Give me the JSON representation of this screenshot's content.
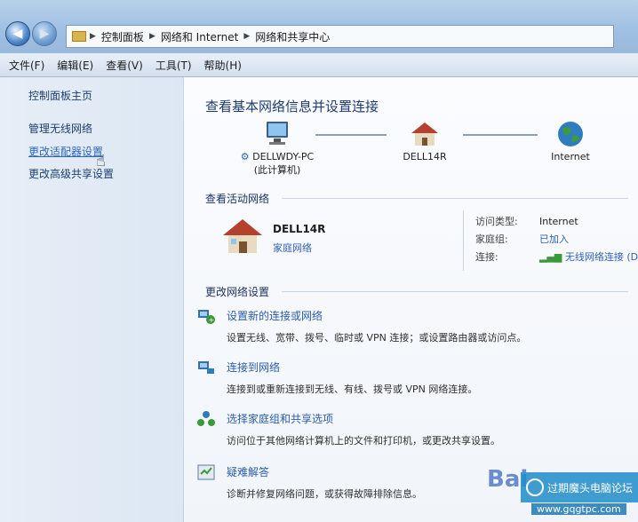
{
  "address": {
    "crumbs": [
      "控制面板",
      "网络和 Internet",
      "网络和共享中心"
    ]
  },
  "menu": [
    "文件(F)",
    "编辑(E)",
    "查看(V)",
    "工具(T)",
    "帮助(H)"
  ],
  "sidebar": {
    "home": "控制面板主页",
    "items": [
      "管理无线网络",
      "更改适配器设置",
      "更改高级共享设置"
    ]
  },
  "main": {
    "heading": "查看基本网络信息并设置连接",
    "map": {
      "pc_name": "DELLWDY-PC",
      "pc_sub": "(此计算机)",
      "router": "DELL14R",
      "internet": "Internet"
    },
    "active": {
      "title": "查看活动网络",
      "network_name": "DELL14R",
      "network_type": "家庭网络",
      "access_label": "访问类型:",
      "access_value": "Internet",
      "homegroup_label": "家庭组:",
      "homegroup_value": "已加入",
      "conn_label": "连接:",
      "conn_value": "无线网络连接 (DELL"
    },
    "change": {
      "title": "更改网络设置",
      "tasks": [
        {
          "title": "设置新的连接或网络",
          "desc": "设置无线、宽带、拨号、临时或 VPN 连接；或设置路由器或访问点。"
        },
        {
          "title": "连接到网络",
          "desc": "连接到或重新连接到无线、有线、拨号或 VPN 网络连接。"
        },
        {
          "title": "选择家庭组和共享选项",
          "desc": "访问位于其他网络计算机上的文件和打印机，或更改共享设置。"
        },
        {
          "title": "疑难解答",
          "desc": "诊断并修复网络问题，或获得故障排除信息。"
        }
      ]
    }
  },
  "watermark": {
    "brand": "Bai",
    "name": "过期魔头电脑论坛",
    "url": "www.gqgtpc.com"
  },
  "colors": {
    "link": "#2f61b8",
    "heading": "#1f3b73"
  }
}
